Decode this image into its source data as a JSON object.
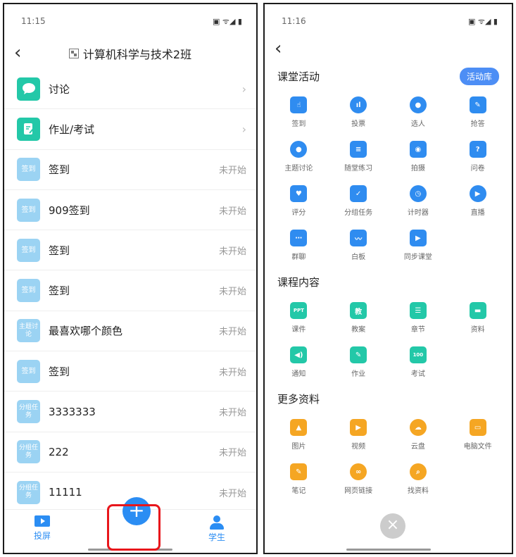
{
  "left": {
    "status_time": "11:15",
    "status_icons": "▣ ᯤ◢ ▮",
    "back_icon": "‹",
    "title": "计算机科学与技术2班",
    "rows": [
      {
        "icon_text": "",
        "icon_kind": "chat-icon",
        "label": "讨论",
        "status": "",
        "chevron": "›",
        "style": "teal"
      },
      {
        "icon_text": "",
        "icon_kind": "homework-icon",
        "label": "作业/考试",
        "status": "",
        "chevron": "›",
        "style": "teal"
      },
      {
        "icon_text": "签到",
        "icon_kind": "signin-badge",
        "label": "签到",
        "status": "未开始",
        "chevron": "",
        "style": "light"
      },
      {
        "icon_text": "签到",
        "icon_kind": "signin-badge",
        "label": "909签到",
        "status": "未开始",
        "chevron": "",
        "style": "light"
      },
      {
        "icon_text": "签到",
        "icon_kind": "signin-badge",
        "label": "签到",
        "status": "未开始",
        "chevron": "",
        "style": "light"
      },
      {
        "icon_text": "签到",
        "icon_kind": "signin-badge",
        "label": "签到",
        "status": "未开始",
        "chevron": "",
        "style": "light"
      },
      {
        "icon_text": "主题讨论",
        "icon_kind": "topic-badge",
        "label": "最喜欢哪个颜色",
        "status": "未开始",
        "chevron": "",
        "style": "light"
      },
      {
        "icon_text": "签到",
        "icon_kind": "signin-badge",
        "label": "签到",
        "status": "未开始",
        "chevron": "",
        "style": "light"
      },
      {
        "icon_text": "分组任务",
        "icon_kind": "group-badge",
        "label": "3333333",
        "status": "未开始",
        "chevron": "",
        "style": "light"
      },
      {
        "icon_text": "分组任务",
        "icon_kind": "group-badge",
        "label": "222",
        "status": "未开始",
        "chevron": "",
        "style": "light"
      },
      {
        "icon_text": "分组任务",
        "icon_kind": "group-badge",
        "label": "11111",
        "status": "未开始",
        "chevron": "",
        "style": "light"
      }
    ],
    "tabs": {
      "screen": "投屏",
      "student": "学生",
      "add": "+"
    }
  },
  "right": {
    "status_time": "11:16",
    "status_icons": "▣ ᯤ◢ ▮",
    "back_icon": "‹",
    "library_button": "活动库",
    "close": "×",
    "sections": [
      {
        "title": "课堂活动",
        "items": [
          {
            "label": "签到",
            "icon": "tap-icon",
            "color": "#2f8cf0",
            "glyph": "☝",
            "round": false
          },
          {
            "label": "投票",
            "icon": "vote-icon",
            "color": "#2f8cf0",
            "glyph": "ıl",
            "round": true
          },
          {
            "label": "选人",
            "icon": "pick-person-icon",
            "color": "#2f8cf0",
            "glyph": "●",
            "round": true
          },
          {
            "label": "抢答",
            "icon": "microphone-icon",
            "color": "#2f8cf0",
            "glyph": "✎",
            "round": false
          },
          {
            "label": "主题讨论",
            "icon": "discussion-icon",
            "color": "#2f8cf0",
            "glyph": "●",
            "round": true
          },
          {
            "label": "随堂练习",
            "icon": "exercise-icon",
            "color": "#2f8cf0",
            "glyph": "≡",
            "round": false
          },
          {
            "label": "拍摄",
            "icon": "camera-icon",
            "color": "#2f8cf0",
            "glyph": "◉",
            "round": false
          },
          {
            "label": "问卷",
            "icon": "questionnaire-icon",
            "color": "#2f8cf0",
            "glyph": "?",
            "round": false
          },
          {
            "label": "评分",
            "icon": "rating-icon",
            "color": "#2f8cf0",
            "glyph": "♥",
            "round": false
          },
          {
            "label": "分组任务",
            "icon": "group-task-icon",
            "color": "#2f8cf0",
            "glyph": "✓",
            "round": false
          },
          {
            "label": "计时器",
            "icon": "timer-icon",
            "color": "#2f8cf0",
            "glyph": "◷",
            "round": true
          },
          {
            "label": "直播",
            "icon": "live-icon",
            "color": "#2f8cf0",
            "glyph": "▶",
            "round": true
          },
          {
            "label": "群聊",
            "icon": "group-chat-icon",
            "color": "#2f8cf0",
            "glyph": "⋯",
            "round": false
          },
          {
            "label": "白板",
            "icon": "whiteboard-icon",
            "color": "#2f8cf0",
            "glyph": "〰",
            "round": false
          },
          {
            "label": "同步课堂",
            "icon": "sync-class-icon",
            "color": "#2f8cf0",
            "glyph": "▶",
            "round": false
          }
        ]
      },
      {
        "title": "课程内容",
        "items": [
          {
            "label": "课件",
            "icon": "ppt-icon",
            "color": "#23c8a8",
            "glyph": "PPT",
            "round": false
          },
          {
            "label": "教案",
            "icon": "lesson-plan-icon",
            "color": "#23c8a8",
            "glyph": "教",
            "round": false
          },
          {
            "label": "章节",
            "icon": "chapter-icon",
            "color": "#23c8a8",
            "glyph": "☰",
            "round": false
          },
          {
            "label": "资料",
            "icon": "folder-icon",
            "color": "#23c8a8",
            "glyph": "▬",
            "round": false
          },
          {
            "label": "通知",
            "icon": "notice-icon",
            "color": "#23c8a8",
            "glyph": "◀)",
            "round": false
          },
          {
            "label": "作业",
            "icon": "homework-icon",
            "color": "#23c8a8",
            "glyph": "✎",
            "round": false
          },
          {
            "label": "考试",
            "icon": "exam-icon",
            "color": "#23c8a8",
            "glyph": "100",
            "round": false
          }
        ]
      },
      {
        "title": "更多资料",
        "items": [
          {
            "label": "图片",
            "icon": "picture-icon",
            "color": "#f5a623",
            "glyph": "▲",
            "round": false
          },
          {
            "label": "视频",
            "icon": "video-icon",
            "color": "#f5a623",
            "glyph": "▶",
            "round": false
          },
          {
            "label": "云盘",
            "icon": "cloud-icon",
            "color": "#f5a623",
            "glyph": "☁",
            "round": true
          },
          {
            "label": "电脑文件",
            "icon": "computer-icon",
            "color": "#f5a623",
            "glyph": "▭",
            "round": false
          },
          {
            "label": "笔记",
            "icon": "note-icon",
            "color": "#f5a623",
            "glyph": "✎",
            "round": false
          },
          {
            "label": "网页链接",
            "icon": "link-icon",
            "color": "#f5a623",
            "glyph": "∞",
            "round": true
          },
          {
            "label": "找资料",
            "icon": "search-icon",
            "color": "#f5a623",
            "glyph": "⌕",
            "round": true
          }
        ]
      }
    ]
  }
}
